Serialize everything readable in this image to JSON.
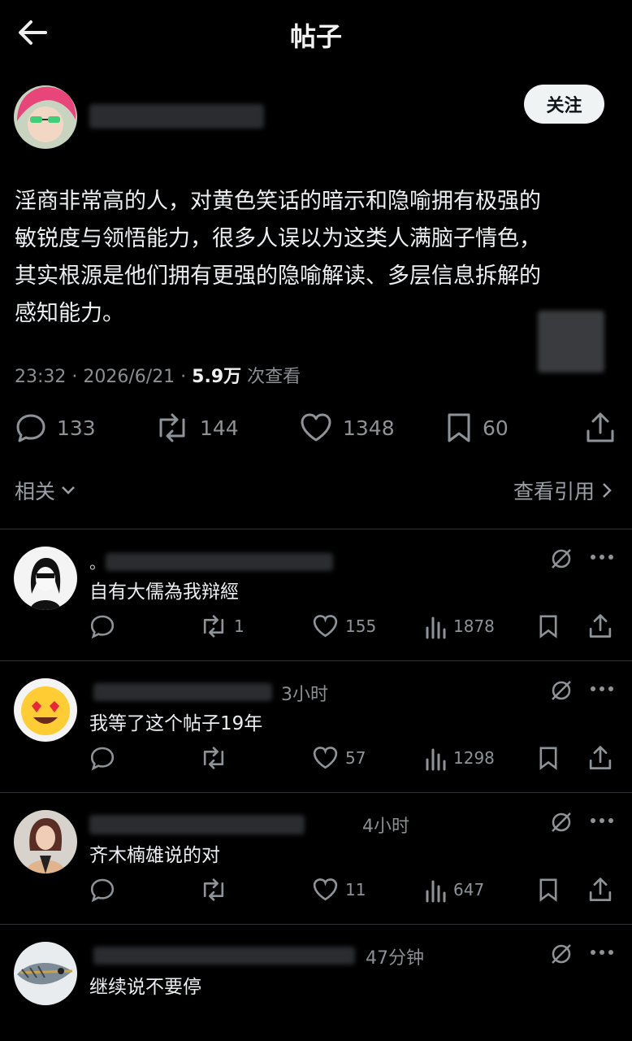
{
  "header": {
    "title": "帖子"
  },
  "post": {
    "follow_label": "关注",
    "text_lines": [
      "淫商非常高的人，对黄色笑话的暗示和隐喻拥有极强的",
      "敏锐度与领悟能力，很多人误以为这类人满脑子情色，",
      "其实根源是他们拥有更强的隐喻解读、多层信息拆解的",
      "感知能力。"
    ],
    "time": "23:32 · 2026/6/21 · ",
    "views": "5.9万",
    "views_suffix": " 次查看",
    "stats": {
      "replies": "133",
      "retweets": "144",
      "likes": "1348",
      "bookmarks": "60"
    }
  },
  "related_label": "相关",
  "quotes_label": "查看引用",
  "comments": [
    {
      "name_prefix": "。",
      "time": "",
      "text": "自有大儒為我辩經",
      "replies": "",
      "retweets": "1",
      "likes": "155",
      "views": "1878"
    },
    {
      "name_prefix": "",
      "time": "3小时",
      "text": "我等了这个帖子19年",
      "replies": "",
      "retweets": "",
      "likes": "57",
      "views": "1298"
    },
    {
      "name_prefix": "",
      "time": "4小时",
      "text": "齐木楠雄说的对",
      "replies": "",
      "retweets": "",
      "likes": "11",
      "views": "647"
    },
    {
      "name_prefix": "",
      "time": "47分钟",
      "text": "继续说不要停",
      "replies": "",
      "retweets": "",
      "likes": "",
      "views": ""
    }
  ],
  "colors": {
    "background": "#000000",
    "text": "#e7e9ea",
    "muted": "#8b8f93",
    "follow_bg": "#eff3f4"
  }
}
